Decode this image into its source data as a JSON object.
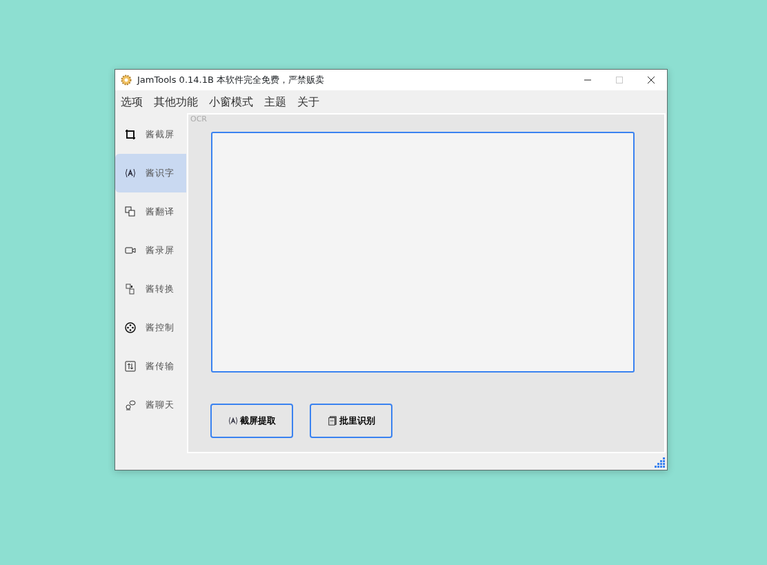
{
  "window": {
    "title": "JamTools 0.14.1B 本软件完全免费，严禁贩卖",
    "controls": [
      {
        "kind": "minimize",
        "disabled": false
      },
      {
        "kind": "maximize",
        "disabled": true
      },
      {
        "kind": "close",
        "disabled": false
      }
    ]
  },
  "menu": [
    "选项",
    "其他功能",
    "小窗模式",
    "主题",
    "关于"
  ],
  "sidebar": {
    "items": [
      {
        "kind": "crop",
        "label": "酱截屏",
        "selected": false
      },
      {
        "kind": "ocr",
        "label": "酱识字",
        "selected": true
      },
      {
        "kind": "translate",
        "label": "酱翻译",
        "selected": false
      },
      {
        "kind": "record",
        "label": "酱录屏",
        "selected": false
      },
      {
        "kind": "convert",
        "label": "酱转换",
        "selected": false
      },
      {
        "kind": "control",
        "label": "酱控制",
        "selected": false
      },
      {
        "kind": "transfer",
        "label": "酱传输",
        "selected": false
      },
      {
        "kind": "chat",
        "label": "酱聊天",
        "selected": false
      }
    ]
  },
  "panel": {
    "title": "OCR",
    "buttons": [
      {
        "kind": "ocr",
        "label": "截屏提取"
      },
      {
        "kind": "batch",
        "label": "批里识别"
      }
    ]
  }
}
